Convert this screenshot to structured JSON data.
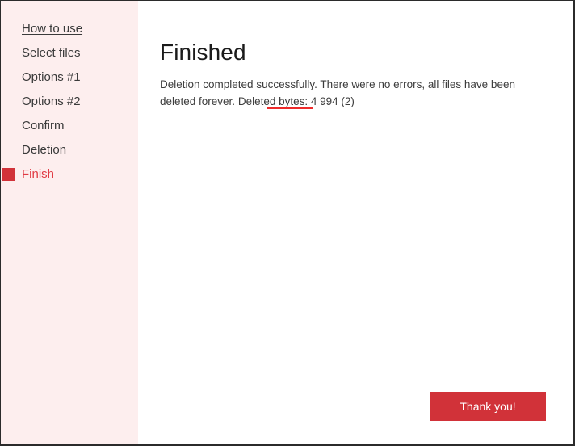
{
  "window": {
    "controls": [
      {
        "name": "more-options",
        "label": "•••",
        "icon": "ellipsis-icon"
      },
      {
        "name": "minimize",
        "label": "—",
        "icon": "minimize-icon"
      },
      {
        "name": "close",
        "label": "✕",
        "icon": "close-icon"
      }
    ]
  },
  "sidebar": {
    "items": [
      {
        "label": "How to use",
        "state": "hovered"
      },
      {
        "label": "Select files",
        "state": "default"
      },
      {
        "label": "Options #1",
        "state": "default"
      },
      {
        "label": "Options #2",
        "state": "default"
      },
      {
        "label": "Confirm",
        "state": "default"
      },
      {
        "label": "Deletion",
        "state": "default"
      },
      {
        "label": "Finish",
        "state": "active"
      }
    ]
  },
  "main": {
    "title": "Finished",
    "message": "Deletion completed successfully. There were no errors, all files have been deleted forever. Deleted bytes: 4 994 (2)",
    "deleted_bytes": "4 994",
    "deleted_count": "2",
    "primary_button": "Thank you!"
  },
  "colors": {
    "sidebar_background": "#fdeeee",
    "accent_red": "#d13239",
    "active_text_red": "#e03a43",
    "annotation_red": "#ee2b2b",
    "body_text": "#3c3c3c",
    "title_text": "#1b1b1b"
  }
}
